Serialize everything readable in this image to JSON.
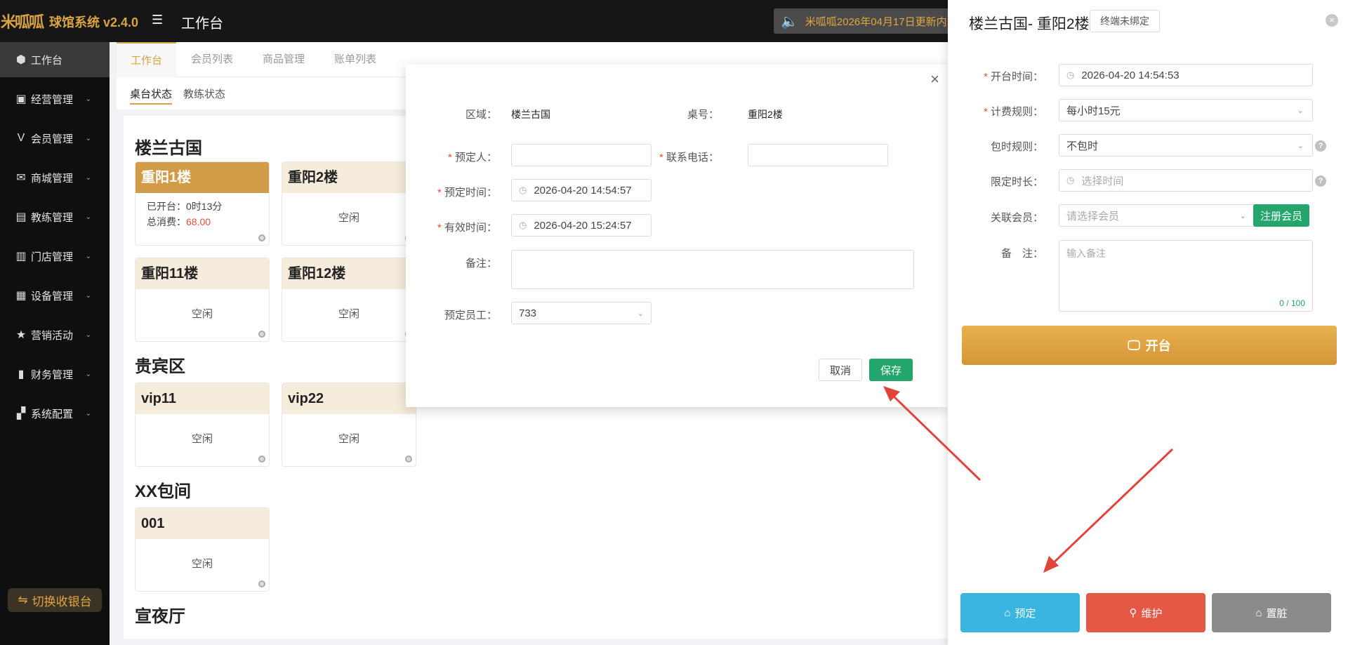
{
  "header": {
    "logo_text": "米呱呱",
    "app_title": "球馆系统 v2.4.0",
    "page_title": "工作台",
    "notice": "米呱呱2026年04月17日更新内"
  },
  "sidebar": {
    "items": [
      {
        "label": "工作台",
        "icon": "cube-icon"
      },
      {
        "label": "经营管理",
        "icon": "briefcase-icon"
      },
      {
        "label": "会员管理",
        "icon": "vip-icon"
      },
      {
        "label": "商城管理",
        "icon": "shop-icon"
      },
      {
        "label": "教练管理",
        "icon": "coach-icon"
      },
      {
        "label": "门店管理",
        "icon": "store-icon"
      },
      {
        "label": "设备管理",
        "icon": "device-icon"
      },
      {
        "label": "营销活动",
        "icon": "star-icon"
      },
      {
        "label": "财务管理",
        "icon": "finance-icon"
      },
      {
        "label": "系统配置",
        "icon": "grid-icon"
      }
    ],
    "switch_label": "切换收银台"
  },
  "tabs": [
    "工作台",
    "会员列表",
    "商品管理",
    "账单列表"
  ],
  "subtabs": [
    "桌台状态",
    "教练状态"
  ],
  "areas": [
    {
      "name": "楼兰古国",
      "tables": [
        {
          "name": "重阳1楼",
          "status": "busy",
          "opened_label": "已开台：",
          "opened_value": "0时13分",
          "total_label": "总消费：",
          "total_value": "68.00"
        },
        {
          "name": "重阳2楼",
          "status": "空闲"
        },
        {
          "name": "重阳11楼",
          "status": "空闲"
        },
        {
          "name": "重阳12楼",
          "status": "空闲"
        }
      ]
    },
    {
      "name": "贵宾区",
      "tables": [
        {
          "name": "vip11",
          "status": "空闲"
        },
        {
          "name": "vip22",
          "status": "空闲"
        }
      ]
    },
    {
      "name": "XX包间",
      "tables": [
        {
          "name": "001",
          "status": "空闲"
        }
      ]
    },
    {
      "name": "宣夜厅",
      "tables": []
    }
  ],
  "modal": {
    "area_label": "区域：",
    "area_value": "楼兰古国",
    "table_label": "桌号：",
    "table_value": "重阳2楼",
    "booker_label": "预定人：",
    "phone_label": "联系电话：",
    "book_time_label": "预定时间：",
    "book_time_value": "2026-04-20 14:54:57",
    "valid_time_label": "有效时间：",
    "valid_time_value": "2026-04-20 15:24:57",
    "remark_label": "备注：",
    "staff_label": "预定员工：",
    "staff_value": "733",
    "cancel": "取消",
    "save": "保存"
  },
  "drawer": {
    "title": "楼兰古国- 重阳2楼",
    "terminal_badge": "终端未绑定",
    "open_time_label": "开台时间：",
    "open_time_value": "2026-04-20 14:54:53",
    "billing_label": "计费规则：",
    "billing_value": "每小时15元",
    "package_label": "包时规则：",
    "package_value": "不包时",
    "limit_label": "限定时长：",
    "limit_placeholder": "选择时间",
    "member_label": "关联会员：",
    "member_placeholder": "请选择会员",
    "register_btn": "注册会员",
    "remark_label": "备　注：",
    "remark_placeholder": "输入备注",
    "remark_count": "0 / 100",
    "open_btn": "开台",
    "reserve_btn": "预定",
    "maint_btn": "维护",
    "dirty_btn": "置脏"
  },
  "colors": {
    "accent": "#d9a441",
    "save": "#24a56b",
    "reserve": "#39b5e0",
    "maintain": "#e55845",
    "dirty": "#8b8b8b",
    "arrow": "#e0443a"
  }
}
